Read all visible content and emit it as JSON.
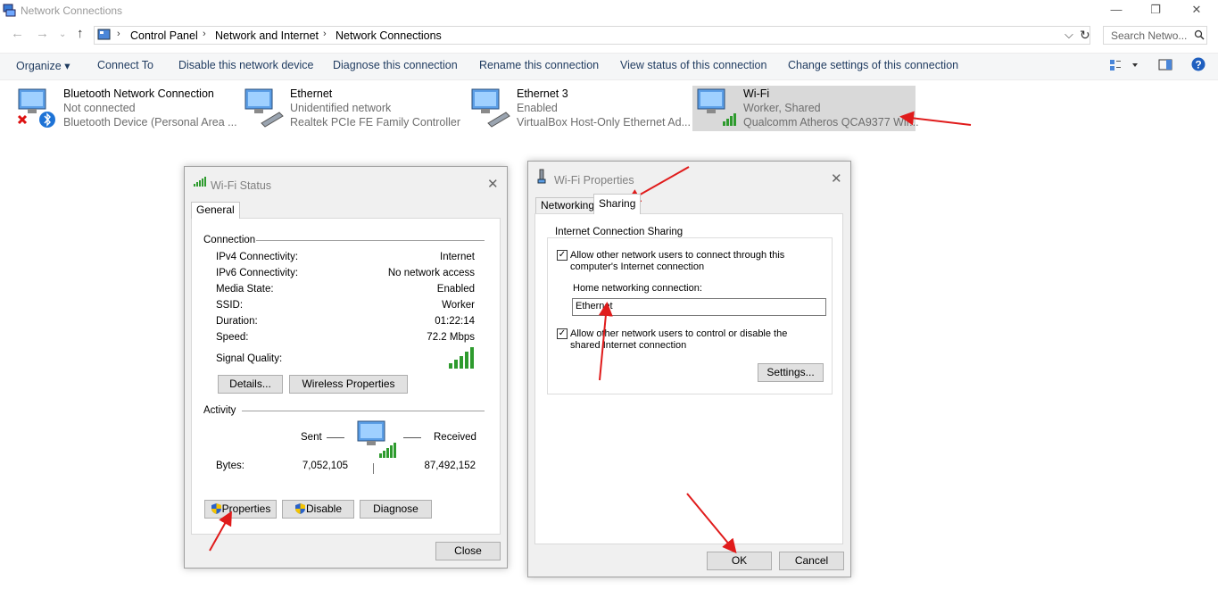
{
  "window": {
    "title": "Network Connections",
    "minimize": "—",
    "restore": "❐",
    "close": "✕"
  },
  "address": {
    "crumbs": [
      "Control Panel",
      "Network and Internet",
      "Network Connections"
    ],
    "search_placeholder": "Search Netwo...",
    "dropdown": "⌵",
    "refresh": "↻"
  },
  "commands": {
    "organize": "Organize ▾",
    "connect_to": "Connect To",
    "disable": "Disable this network device",
    "diagnose": "Diagnose this connection",
    "rename": "Rename this connection",
    "view_status": "View status of this connection",
    "change_settings": "Change settings of this connection"
  },
  "adapters": [
    {
      "name": "Bluetooth Network Connection",
      "status": "Not connected",
      "device": "Bluetooth Device (Personal Area ..."
    },
    {
      "name": "Ethernet",
      "status": "Unidentified network",
      "device": "Realtek PCIe FE Family Controller"
    },
    {
      "name": "Ethernet 3",
      "status": "Enabled",
      "device": "VirtualBox Host-Only Ethernet Ad..."
    },
    {
      "name": "Wi-Fi",
      "status": "Worker, Shared",
      "device": "Qualcomm Atheros QCA9377 Wir..."
    }
  ],
  "wifi_status": {
    "title": "Wi-Fi Status",
    "tab": "General",
    "connection_header": "Connection",
    "rows": [
      {
        "label": "IPv4 Connectivity:",
        "value": "Internet"
      },
      {
        "label": "IPv6 Connectivity:",
        "value": "No network access"
      },
      {
        "label": "Media State:",
        "value": "Enabled"
      },
      {
        "label": "SSID:",
        "value": "Worker"
      },
      {
        "label": "Duration:",
        "value": "01:22:14"
      },
      {
        "label": "Speed:",
        "value": "72.2 Mbps"
      }
    ],
    "signal_label": "Signal Quality:",
    "details_btn": "Details...",
    "wireless_btn": "Wireless Properties",
    "activity_header": "Activity",
    "sent_label": "Sent",
    "received_label": "Received",
    "bytes_label": "Bytes:",
    "bytes_sent": "7,052,105",
    "bytes_received": "87,492,152",
    "properties_btn": "Properties",
    "disable_btn": "Disable",
    "diagnose_btn": "Diagnose",
    "close_btn": "Close"
  },
  "wifi_props": {
    "title": "Wi-Fi Properties",
    "tab_networking": "Networking",
    "tab_sharing": "Sharing",
    "group_title": "Internet Connection Sharing",
    "allow_connect_line1": "Allow other network users to connect through this",
    "allow_connect_line2": "computer's Internet connection",
    "allow_connect_checked": true,
    "home_label": "Home networking connection:",
    "home_value": "Ethernet",
    "allow_control_line1": "Allow other network users to control or disable the",
    "allow_control_line2": "shared Internet connection",
    "allow_control_checked": true,
    "settings_btn": "Settings...",
    "ok_btn": "OK",
    "cancel_btn": "Cancel"
  },
  "colors": {
    "annotation_arrow": "#e01b1b",
    "accent": "#1e3a5f",
    "selected_bg": "#d9d9d9"
  }
}
